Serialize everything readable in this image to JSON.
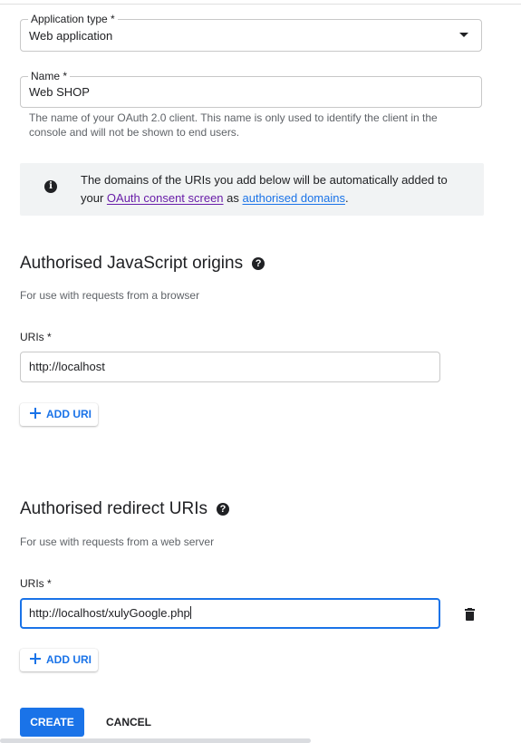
{
  "app_type": {
    "label": "Application type *",
    "value": "Web application"
  },
  "name_field": {
    "label": "Name *",
    "value": "Web SHOP",
    "hint": "The name of your OAuth 2.0 client. This name is only used to identify the client in the console and will not be shown to end users."
  },
  "info": {
    "text_before": "The domains of the URIs you add below will be automatically added to your ",
    "link1": "OAuth consent screen",
    "middle": " as ",
    "link2": "authorised domains",
    "end": "."
  },
  "js_origins": {
    "title": "Authorised JavaScript origins",
    "subtitle": "For use with requests from a browser",
    "uris_label": "URIs *",
    "uri_value": "http://localhost",
    "add_label": "ADD URI"
  },
  "redirect": {
    "title": "Authorised redirect URIs",
    "subtitle": "For use with requests from a web server",
    "uris_label": "URIs *",
    "uri_value": "http://localhost/xulyGoogle.php",
    "add_label": "ADD URI"
  },
  "actions": {
    "create": "CREATE",
    "cancel": "CANCEL"
  },
  "icons": {
    "info": "info-icon",
    "help": "help-icon",
    "dropdown": "chevron-down-icon",
    "add": "plus-icon",
    "delete": "trash-icon"
  },
  "colors": {
    "accent": "#1a73e8",
    "visited_link": "#681da8",
    "info_bg": "#f1f3f4"
  }
}
